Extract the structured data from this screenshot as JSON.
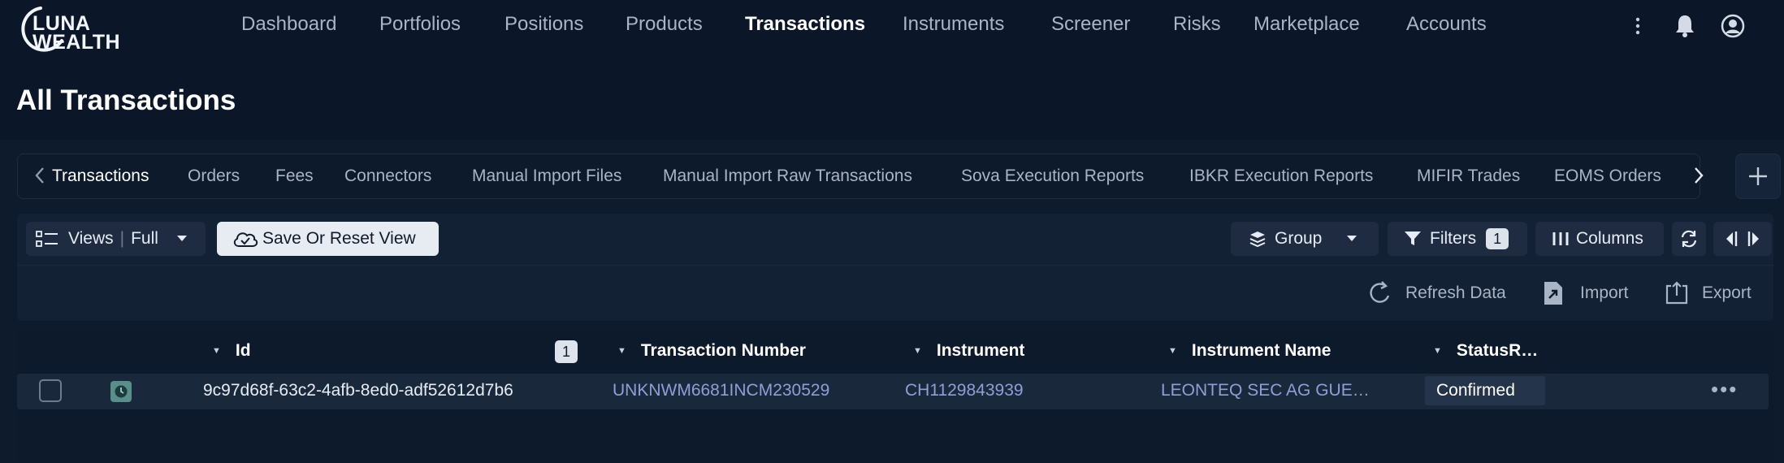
{
  "brand": {
    "line1": "LUNA",
    "line2": "WEALTH"
  },
  "nav": {
    "items": [
      "Dashboard",
      "Portfolios",
      "Positions",
      "Products",
      "Transactions",
      "Instruments",
      "Screener",
      "Risks",
      "Marketplace",
      "Accounts"
    ],
    "active": "Transactions"
  },
  "page": {
    "title": "All Transactions"
  },
  "tabs": {
    "items": [
      "Transactions",
      "Orders",
      "Fees",
      "Connectors",
      "Manual Import Files",
      "Manual Import Raw Transactions",
      "Sova Execution Reports",
      "IBKR Execution Reports",
      "MIFIR Trades",
      "EOMS Orders"
    ],
    "active": "Transactions"
  },
  "toolbar": {
    "views_label": "Views",
    "views_value": "Full",
    "save_reset_label": "Save Or Reset View",
    "group_label": "Group",
    "filters_label": "Filters",
    "filters_count": "1",
    "columns_label": "Columns"
  },
  "actions": {
    "refresh_label": "Refresh Data",
    "import_label": "Import",
    "export_label": "Export"
  },
  "table": {
    "columns": [
      "Id",
      "Transaction Number",
      "Instrument",
      "Instrument Name",
      "StatusR…"
    ],
    "id_sort_badge": "1",
    "rows": [
      {
        "id": "9c97d68f-63c2-4afb-8ed0-adf52612d7b6",
        "transaction_number": "UNKNWM6681INCM230529",
        "instrument": "CH1129843939",
        "instrument_name": "LEONTEQ SEC AG GUE…",
        "status": "Confirmed"
      }
    ]
  },
  "colors": {
    "background": "#0b1728",
    "link": "#8f9fd6",
    "status_icon": "#5a8e8b"
  }
}
